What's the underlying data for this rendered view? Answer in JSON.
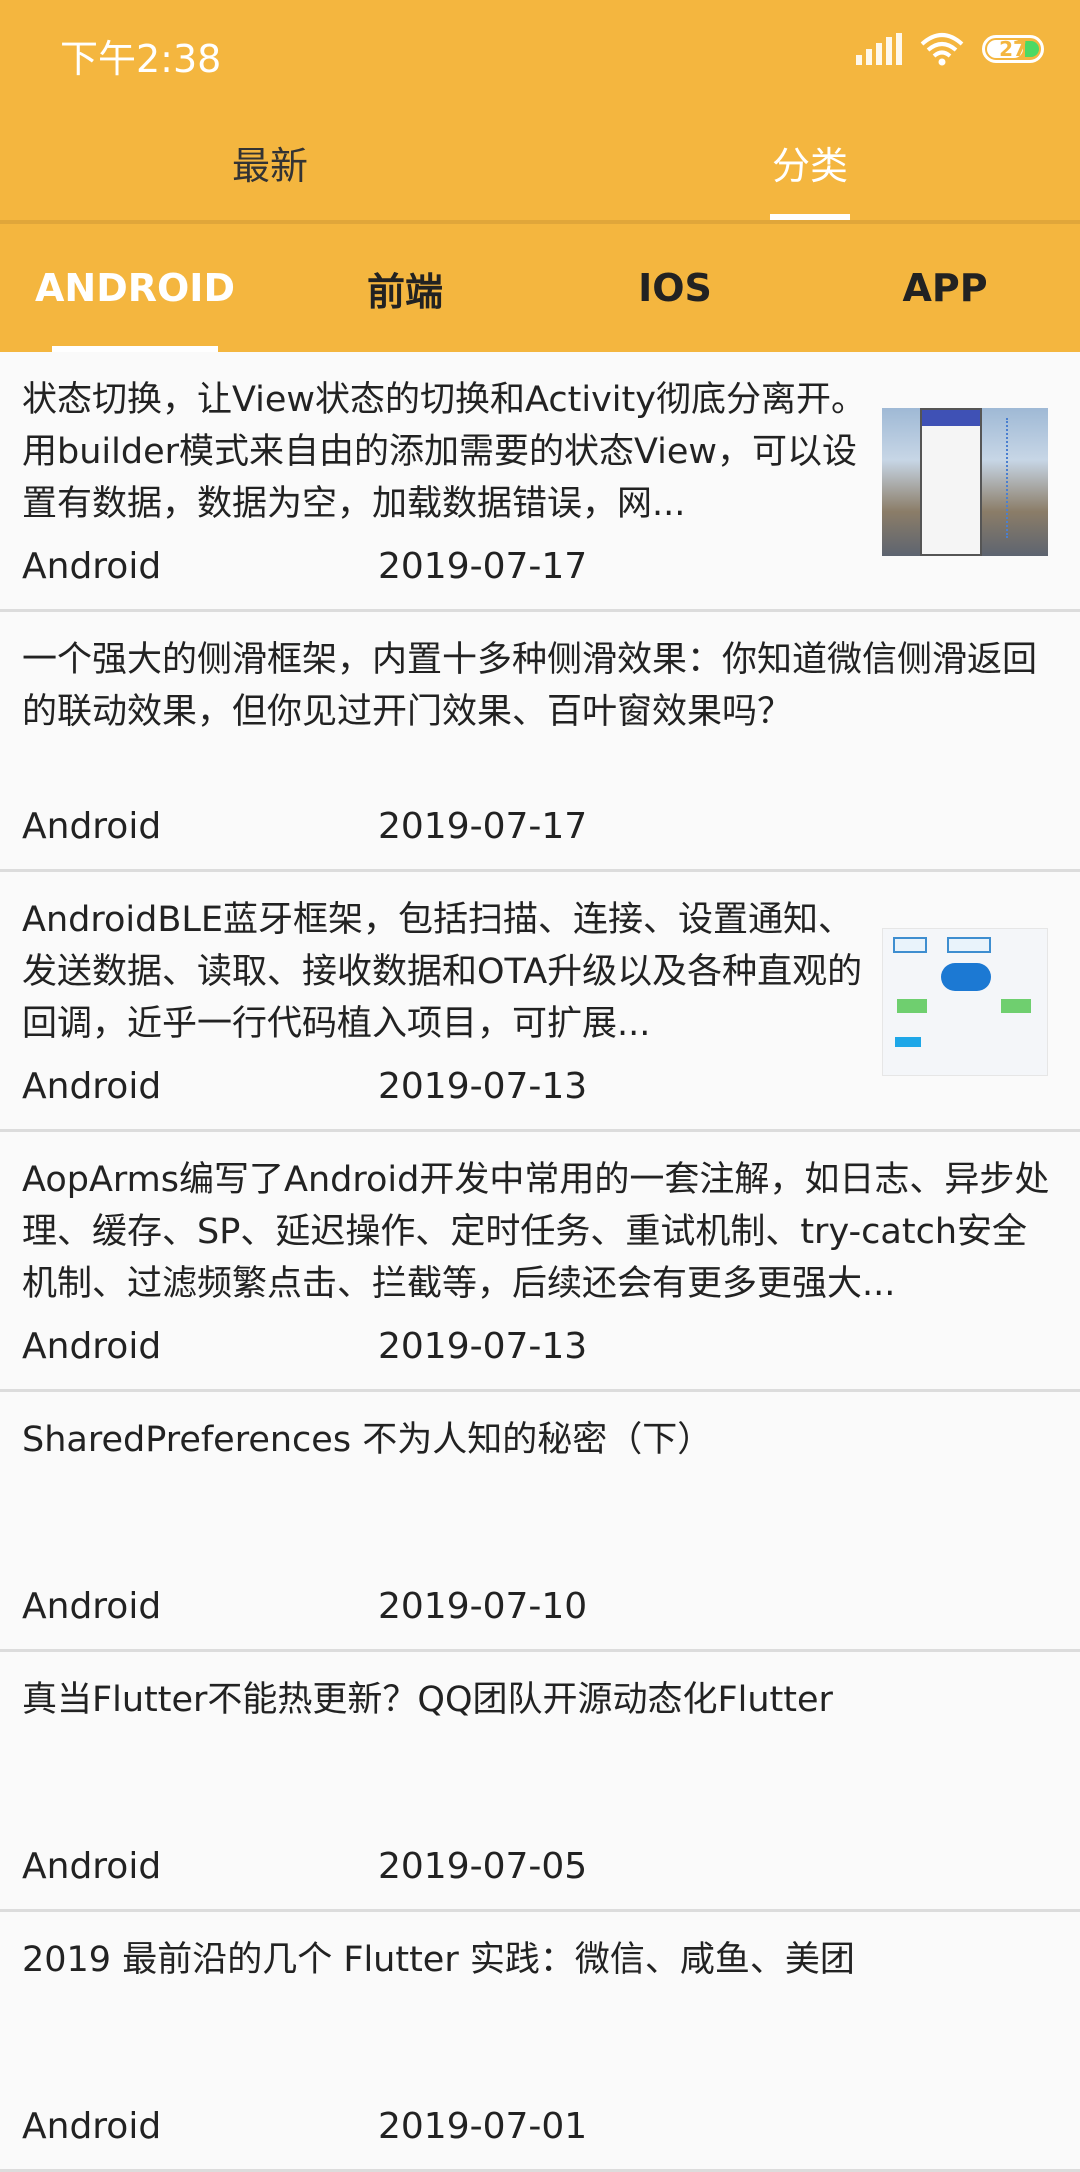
{
  "status_bar": {
    "time": "下午2:38",
    "battery": "27"
  },
  "top_tabs": [
    {
      "label": "最新",
      "active": false
    },
    {
      "label": "分类",
      "active": true
    }
  ],
  "category_tabs": [
    {
      "label": "ANDROID",
      "active": true
    },
    {
      "label": "前端",
      "active": false
    },
    {
      "label": "IOS",
      "active": false
    },
    {
      "label": "APP",
      "active": false
    }
  ],
  "articles": [
    {
      "title": "状态切换，让View状态的切换和Activity彻底分离开。用builder模式来自由的添加需要的状态View，可以设置有数据，数据为空，加载数据错误，网...",
      "category": "Android",
      "date": "2019-07-17"
    },
    {
      "title": "一个强大的侧滑框架，内置十多种侧滑效果：你知道微信侧滑返回的联动效果，但你见过开门效果、百叶窗效果吗？",
      "category": "Android",
      "date": "2019-07-17"
    },
    {
      "title": "AndroidBLE蓝牙框架，包括扫描、连接、设置通知、发送数据、读取、接收数据和OTA升级以及各种直观的回调，近乎一行代码植入项目，可扩展...",
      "category": "Android",
      "date": "2019-07-13"
    },
    {
      "title": "AopArms编写了Android开发中常用的一套注解，如日志、异步处理、缓存、SP、延迟操作、定时任务、重试机制、try-catch安全机制、过滤频繁点击、拦截等，后续还会有更多更强大...",
      "category": "Android",
      "date": "2019-07-13"
    },
    {
      "title": "SharedPreferences 不为人知的秘密（下）",
      "category": "Android",
      "date": "2019-07-10"
    },
    {
      "title": "真当Flutter不能热更新？QQ团队开源动态化Flutter",
      "category": "Android",
      "date": "2019-07-05"
    },
    {
      "title": "2019 最前沿的几个 Flutter 实践：微信、咸鱼、美团",
      "category": "Android",
      "date": "2019-07-01"
    }
  ]
}
